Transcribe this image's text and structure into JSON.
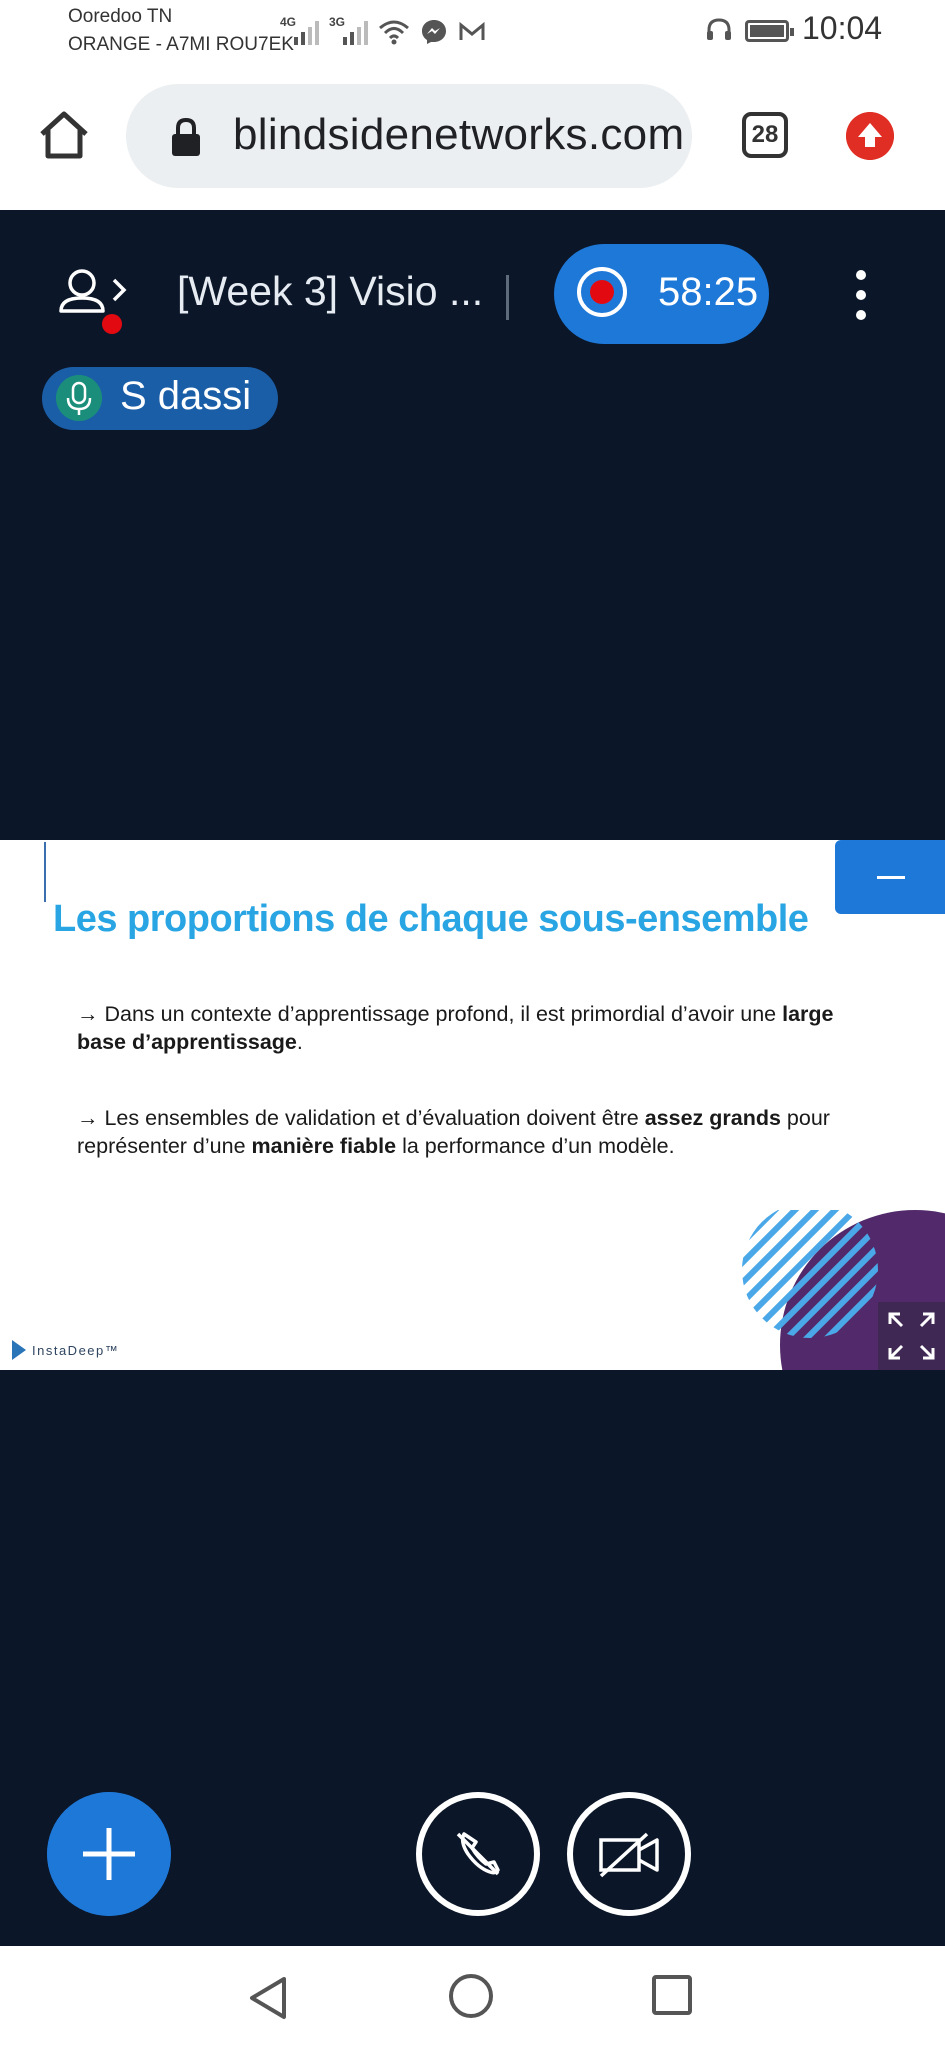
{
  "status_bar": {
    "carrier_1": "Ooredoo TN",
    "carrier_2": "ORANGE - A7MI ROU7EK",
    "signal_1_label": "4G",
    "signal_2_label": "3G",
    "time": "10:04"
  },
  "browser": {
    "url": "blindsidenetworks.com",
    "tab_count": "28"
  },
  "meeting": {
    "title": "[Week 3] Visio ...",
    "record_time": "58:25",
    "talker_name": "S dassi"
  },
  "slide": {
    "title": "Les proportions de chaque sous-ensemble",
    "bullet_1": {
      "arrow": "→",
      "part_1": " Dans un contexte d’apprentissage profond, il est primordial d’avoir une ",
      "bold_1": "large base d’apprentissage",
      "part_2": "."
    },
    "bullet_2": {
      "arrow": "→",
      "part_1": " Les ensembles de validation et d’évaluation doivent être ",
      "bold_1": "assez grands",
      "part_2": " pour représenter d’une ",
      "bold_2": "manière fiable",
      "part_3": " la performance d’un modèle."
    },
    "logo_text": "InstaDeep™"
  },
  "colors": {
    "background": "#0b1729",
    "accent_blue": "#1e78d8",
    "slide_title": "#2aa5e3",
    "record_red": "#e20a10",
    "upgrade_red": "#e02e24"
  },
  "icons": {
    "home": "home-icon",
    "lock": "lock-icon",
    "users": "user-list-icon",
    "record": "record-icon",
    "more": "more-vertical-icon",
    "mic": "microphone-icon",
    "minimize": "minimize-icon",
    "fullscreen": "fullscreen-icon",
    "plus": "plus-icon",
    "audio_off": "phone-muted-icon",
    "video_off": "camera-off-icon"
  }
}
